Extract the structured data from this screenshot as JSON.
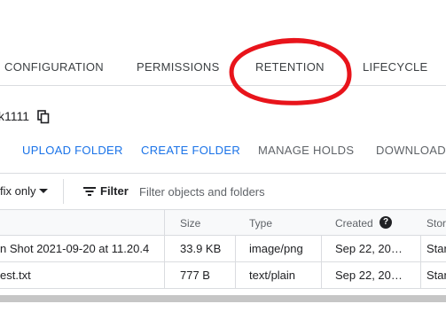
{
  "tabs": [
    {
      "label": "CONFIGURATION"
    },
    {
      "label": "PERMISSIONS"
    },
    {
      "label": "RETENTION"
    },
    {
      "label": "LIFECYCLE"
    }
  ],
  "bucket": {
    "name": "k1111",
    "copy_icon": "copy-icon"
  },
  "actions": {
    "upload_folder": "UPLOAD FOLDER",
    "create_folder": "CREATE FOLDER",
    "manage_holds": "MANAGE HOLDS",
    "download": "DOWNLOAD"
  },
  "filter_bar": {
    "prefix_mode": "fix only",
    "filter_label": "Filter",
    "placeholder": "Filter objects and folders"
  },
  "table": {
    "columns": [
      "Size",
      "Type",
      "Created",
      "Stor"
    ],
    "rows": [
      {
        "name": "n Shot 2021-09-20 at 11.20.4",
        "size": "33.9 KB",
        "type": "image/png",
        "created": "Sep 22, 20…",
        "storage": "Star"
      },
      {
        "name": "est.txt",
        "size": "777 B",
        "type": "text/plain",
        "created": "Sep 22, 20…",
        "storage": "Star"
      }
    ]
  },
  "colors": {
    "accent": "#1a73e8",
    "annotation": "#e8141b"
  }
}
